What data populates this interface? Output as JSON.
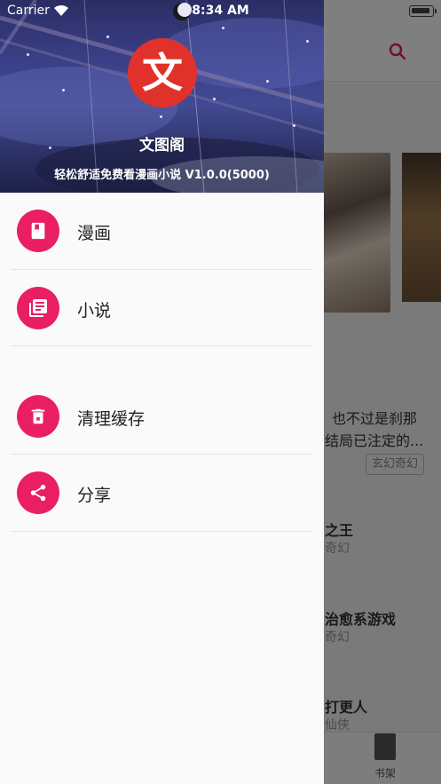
{
  "status_bar": {
    "carrier": "Carrier",
    "time": "8:34 AM"
  },
  "drawer": {
    "app_name": "文图阁",
    "app_desc": "轻松舒适免费看漫画小说 V1.0.0(5000)",
    "logo_char": "文",
    "menu": [
      {
        "label": "漫画",
        "icon": "book-icon"
      },
      {
        "label": "小说",
        "icon": "library-books-icon"
      },
      {
        "label": "清理缓存",
        "icon": "delete-icon"
      },
      {
        "label": "分享",
        "icon": "share-icon"
      }
    ]
  },
  "background": {
    "text_line1": "也不过是刹那",
    "text_line2": "结局已注定的...",
    "tag": "玄幻奇幻",
    "item1_title": "之王",
    "item1_sub": "奇幻",
    "item2_title": "治愈系游戏",
    "item2_sub": "奇幻",
    "item3_title": "打更人",
    "item3_sub": "仙侠",
    "tab_label": "书架"
  },
  "colors": {
    "accent": "#e91e63",
    "logo_red": "#e0322b",
    "search_icon": "#e91e63"
  }
}
